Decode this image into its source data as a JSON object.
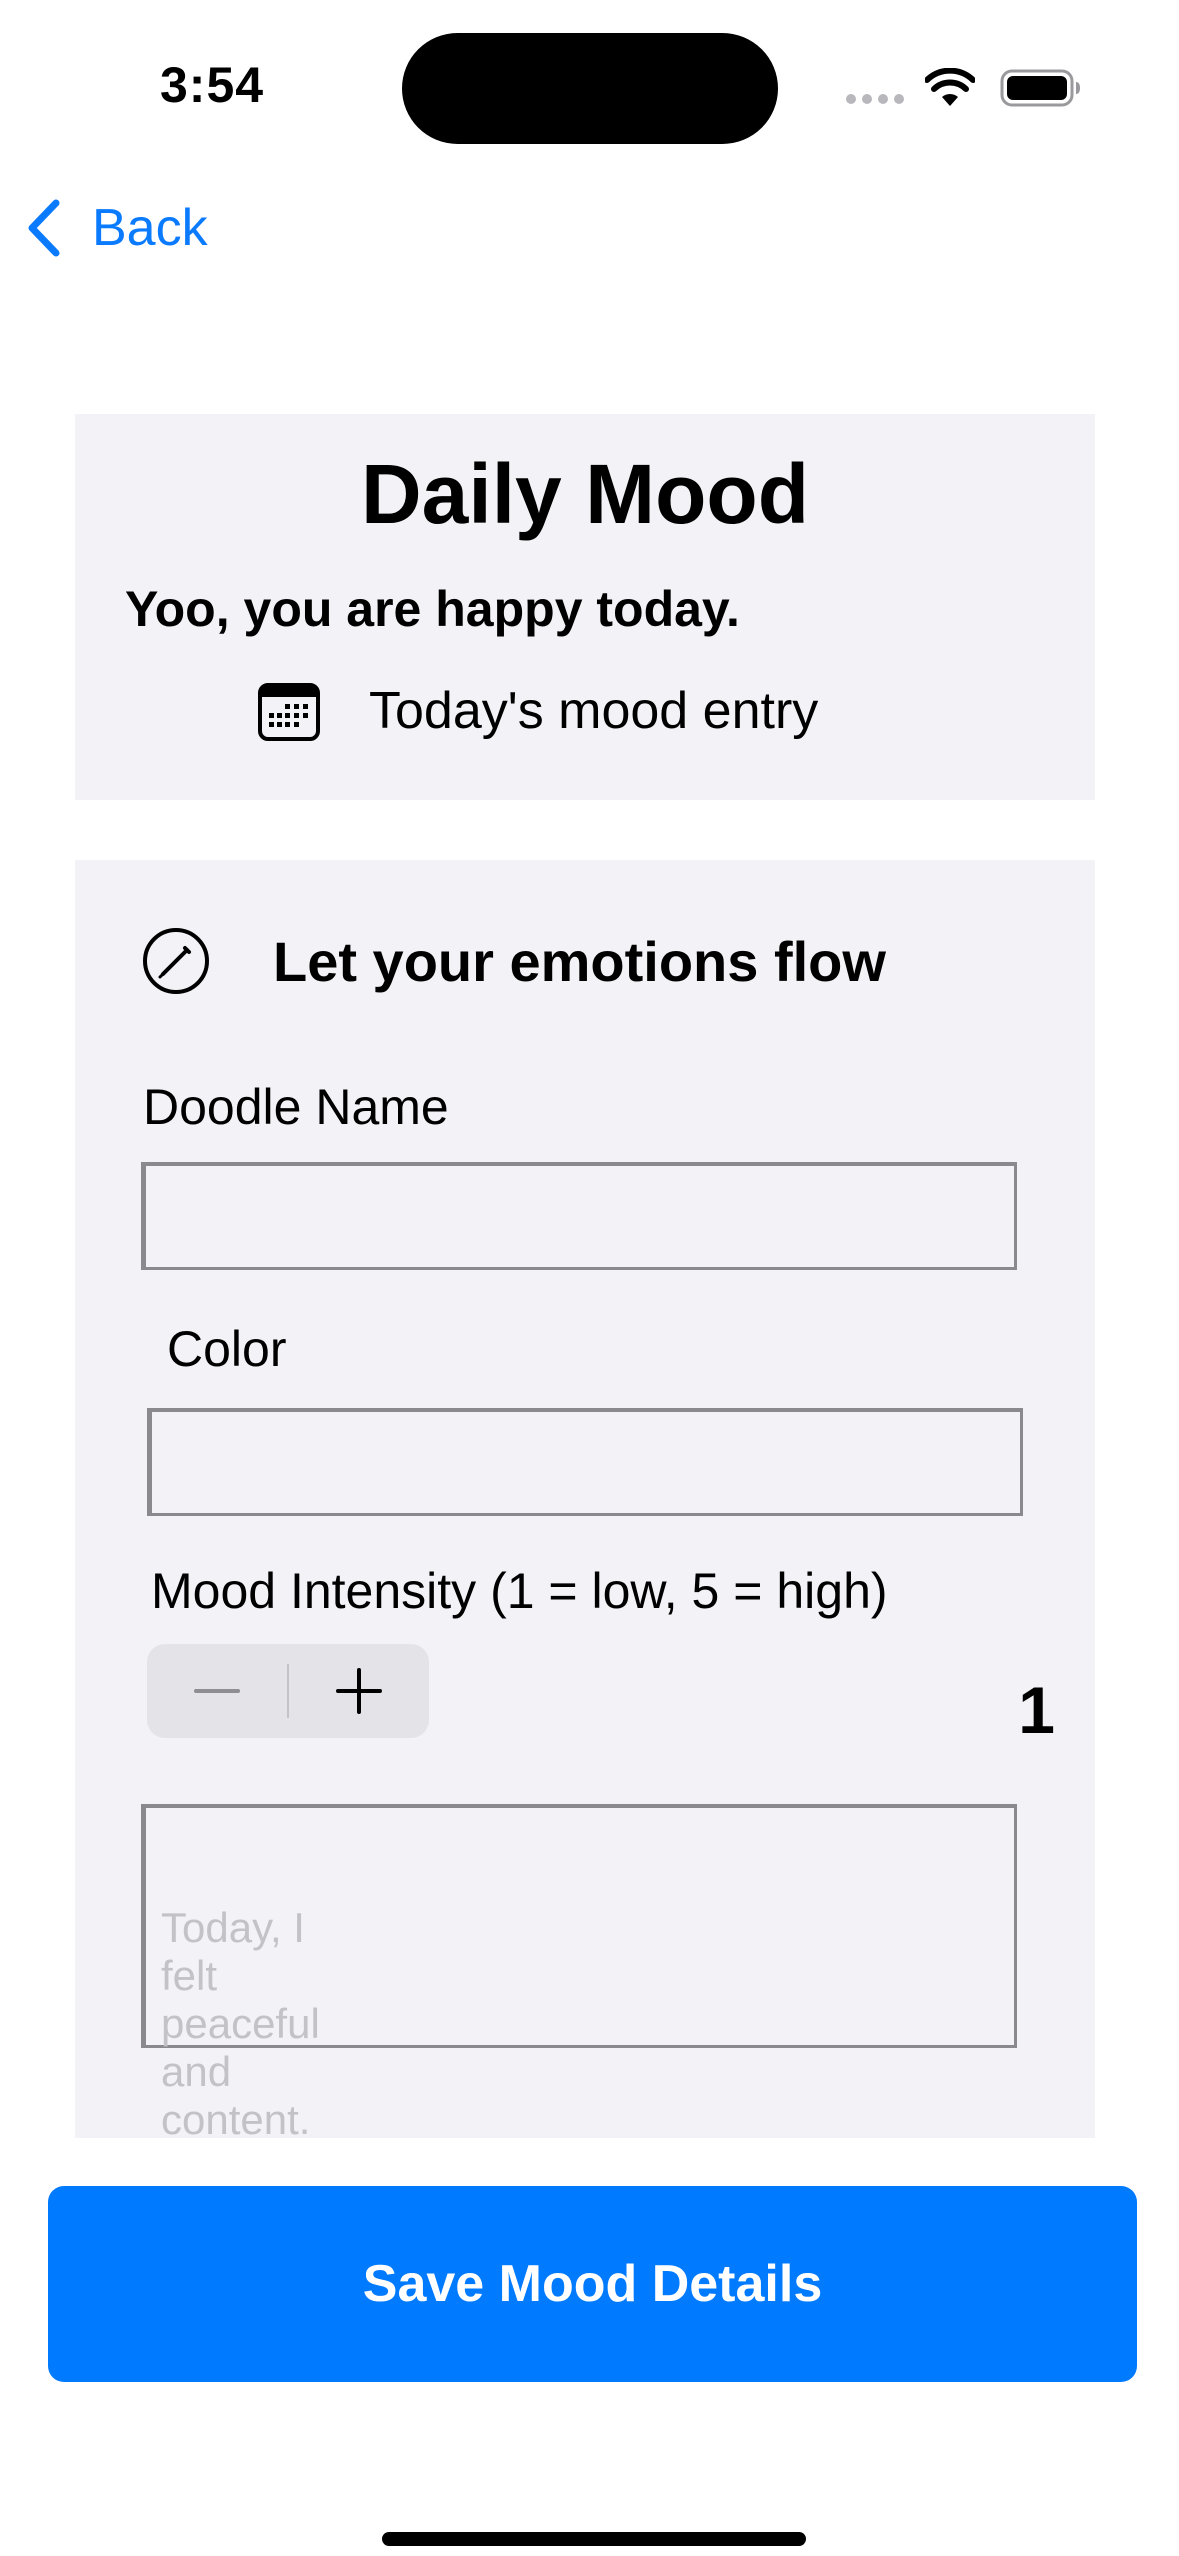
{
  "status_bar": {
    "time": "3:54",
    "icons": [
      "signal-dots-icon",
      "wifi-icon",
      "battery-icon"
    ]
  },
  "nav": {
    "back_label": "Back",
    "back_icon": "chevron-left-icon"
  },
  "header": {
    "title": "Daily Mood",
    "subtitle": "Yoo, you are happy today.",
    "entry_label": "Today's mood entry",
    "entry_icon": "calendar-icon"
  },
  "form": {
    "section_title": "Let your emotions flow",
    "section_icon": "pencil-circle-icon",
    "doodle_name_label": "Doodle Name",
    "doodle_name_value": "",
    "color_label": "Color",
    "color_value": "",
    "intensity_label": "Mood Intensity (1 = low, 5 = high)",
    "intensity_value": "1",
    "notes_placeholder": "Today, I felt peaceful and content.",
    "notes_value": ""
  },
  "actions": {
    "save_label": "Save Mood Details"
  },
  "colors": {
    "accent": "#007AFF",
    "link": "#0A7AFF",
    "card_background": "#F2F2F7",
    "stepper_background": "#E3E3E8",
    "field_border": "#8A8A8E",
    "placeholder": "#C3C3C7"
  }
}
